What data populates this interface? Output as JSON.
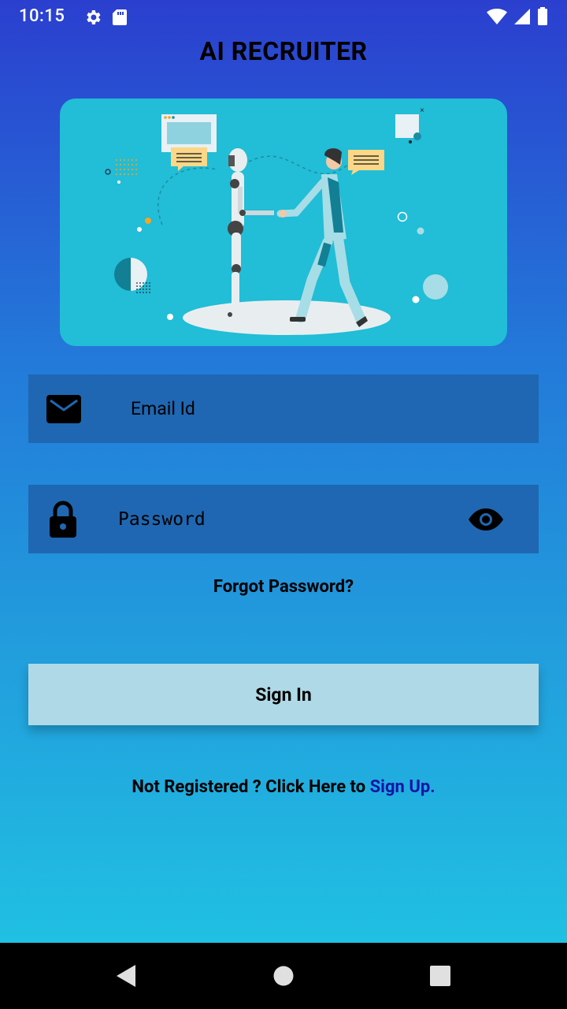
{
  "status_bar": {
    "time": "10:15",
    "left_icons": [
      "gear-icon",
      "sd-card-icon"
    ],
    "right_icons": [
      "wifi-icon",
      "signal-icon",
      "battery-icon"
    ]
  },
  "app": {
    "title": "AI RECRUITER"
  },
  "hero": {
    "illustration": "robot-handshake-illustration"
  },
  "login_form": {
    "email": {
      "icon": "mail-icon",
      "placeholder": "Email Id",
      "value": ""
    },
    "password": {
      "icon": "lock-icon",
      "placeholder": "Password",
      "value": "",
      "toggle_icon": "eye-icon"
    },
    "forgot_password_label": "Forgot Password?",
    "sign_in_label": "Sign In",
    "register_prefix": "Not Registered ? Click Here to ",
    "register_link_label": "Sign Up."
  },
  "nav_bar": {
    "buttons": [
      "back-icon",
      "home-icon",
      "recents-icon"
    ]
  },
  "colors": {
    "field_background": "#1f67b2",
    "button_background": "#afd9e6",
    "link": "#1315a8",
    "hero_background": "#22bdd6"
  }
}
